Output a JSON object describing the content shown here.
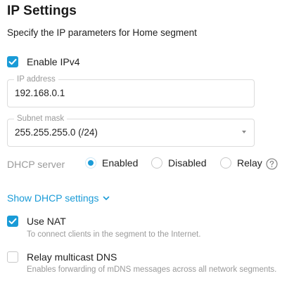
{
  "page": {
    "title": "IP Settings",
    "subtitle": "Specify the IP parameters for Home segment"
  },
  "enable_ipv4": {
    "label": "Enable IPv4",
    "checked": true
  },
  "ip_address": {
    "legend": "IP address",
    "value": "192.168.0.1"
  },
  "subnet_mask": {
    "legend": "Subnet mask",
    "value": "255.255.255.0 (/24)"
  },
  "dhcp": {
    "label": "DHCP server",
    "options": [
      {
        "label": "Enabled",
        "selected": true
      },
      {
        "label": "Disabled",
        "selected": false
      },
      {
        "label": "Relay",
        "selected": false
      }
    ],
    "help_icon": "question-circle-icon"
  },
  "show_dhcp": {
    "label": "Show DHCP settings",
    "icon": "chevron-down-icon"
  },
  "use_nat": {
    "label": "Use NAT",
    "checked": true,
    "hint": "To connect clients in the segment to the Internet."
  },
  "relay_mdns": {
    "label": "Relay multicast DNS",
    "checked": false,
    "hint": "Enables forwarding of mDNS messages across all network segments."
  },
  "colors": {
    "accent": "#1a9bd7",
    "muted_text": "#9a9a9a",
    "border": "#dcdcdc"
  }
}
